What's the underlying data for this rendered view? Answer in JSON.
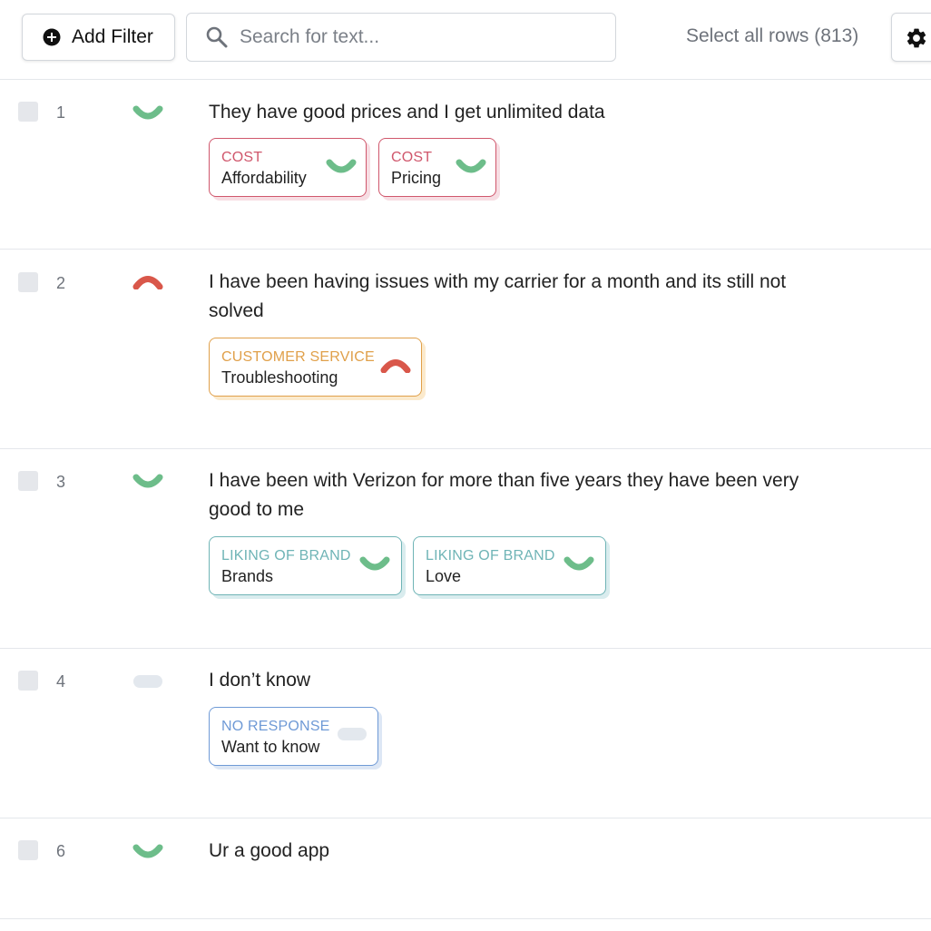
{
  "toolbar": {
    "add_filter_label": "Add Filter",
    "search_placeholder": "Search for text...",
    "select_all_label": "Select all rows (813)"
  },
  "colors": {
    "positive": "#6dbd8a",
    "negative": "#d9574a",
    "neutral": "#e3e8ee",
    "cost": "#d0576c",
    "customer_service": "#e0a04a",
    "liking_of_brand": "#6fb4b6",
    "no_response": "#6f9ad6"
  },
  "rows": [
    {
      "number": "1",
      "sentiment": "positive",
      "text": "They have good prices and I get unlimited data",
      "tags": [
        {
          "category": "COST",
          "label": "Affordability",
          "sentiment": "positive"
        },
        {
          "category": "COST",
          "label": "Pricing",
          "sentiment": "positive"
        }
      ]
    },
    {
      "number": "2",
      "sentiment": "negative",
      "text": "I have been having issues with my carrier for a month and its still not solved",
      "tags": [
        {
          "category": "CUSTOMER SERVICE",
          "label": "Troubleshooting",
          "sentiment": "negative"
        }
      ]
    },
    {
      "number": "3",
      "sentiment": "positive",
      "text": "I have been with Verizon for more than five years they have been very good to me",
      "tags": [
        {
          "category": "LIKING OF BRAND",
          "label": "Brands",
          "sentiment": "positive"
        },
        {
          "category": "LIKING OF BRAND",
          "label": "Love",
          "sentiment": "positive"
        }
      ]
    },
    {
      "number": "4",
      "sentiment": "neutral",
      "text": "I don’t know",
      "tags": [
        {
          "category": "NO RESPONSE",
          "label": "Want to know",
          "sentiment": "neutral"
        }
      ]
    },
    {
      "number": "6",
      "sentiment": "positive",
      "text": "Ur a good app",
      "tags": []
    }
  ]
}
